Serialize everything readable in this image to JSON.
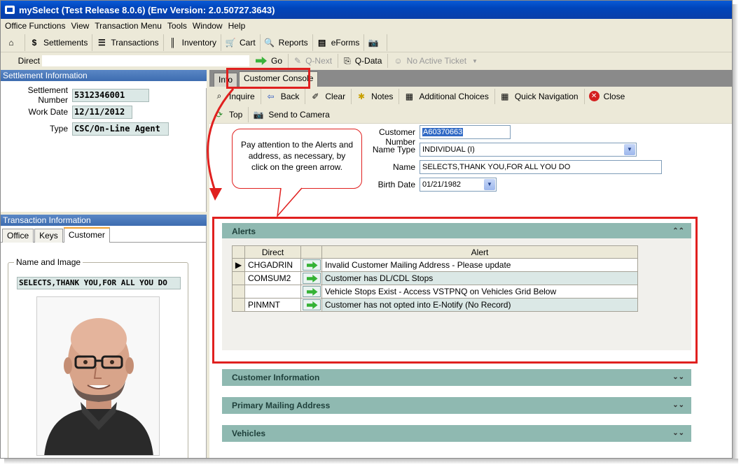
{
  "window": {
    "title": "mySelect (Test Release 8.0.6) (Env Version: 2.0.50727.3643)"
  },
  "menu": [
    "Office Functions",
    "View",
    "Transaction Menu",
    "Tools",
    "Window",
    "Help"
  ],
  "toolbar": {
    "settlements": "Settlements",
    "transactions": "Transactions",
    "inventory": "Inventory",
    "cart": "Cart",
    "reports": "Reports",
    "eforms": "eForms"
  },
  "direct_bar": {
    "label": "Direct",
    "go": "Go",
    "q_next": "Q-Next",
    "q_data": "Q-Data",
    "ticket": "No Active Ticket"
  },
  "settlement": {
    "title": "Settlement Information",
    "number_label": "Settlement Number",
    "number_value": "5312346001",
    "workdate_label": "Work Date",
    "workdate_value": "12/11/2012",
    "type_label": "Type",
    "type_value": "CSC/On-Line Agent"
  },
  "transaction": {
    "title": "Transaction Information",
    "tabs": [
      "Office",
      "Keys",
      "Customer"
    ],
    "group_label": "Name and Image",
    "name_value": "SELECTS,THANK YOU,FOR ALL YOU DO"
  },
  "console": {
    "tabs": [
      "Info",
      "Customer Console"
    ],
    "buttons": {
      "inquire": "Inquire",
      "back": "Back",
      "clear": "Clear",
      "notes": "Notes",
      "additional": "Additional Choices",
      "quicknav": "Quick Navigation",
      "close": "Close",
      "top": "Top",
      "send": "Send to Camera"
    }
  },
  "form": {
    "customer_number_label": "Customer Number",
    "customer_number_value": "A60370663",
    "name_type_label": "Name Type",
    "name_type_value": "INDIVIDUAL (I)",
    "name_label": "Name",
    "name_value": "SELECTS,THANK YOU,FOR ALL YOU DO",
    "birth_label": "Birth Date",
    "birth_value": "01/21/1982"
  },
  "callout": "Pay attention to the Alerts and address, as necessary, by click on the green arrow.",
  "sections": {
    "alerts": "Alerts",
    "customer_info": "Customer Information",
    "mailing": "Primary Mailing Address",
    "vehicles": "Vehicles"
  },
  "alerts_grid": {
    "headers": [
      "Direct",
      "Alert"
    ],
    "rows": [
      {
        "direct": "CHGADRIN",
        "alert": "Invalid Customer Mailing Address - Please update"
      },
      {
        "direct": "COMSUM2",
        "alert": "Customer has DL/CDL Stops"
      },
      {
        "direct": "",
        "alert": "Vehicle Stops Exist - Access VSTPNQ on Vehicles Grid Below"
      },
      {
        "direct": "PINMNT",
        "alert": "Customer has not opted into E-Notify (No Record)"
      }
    ]
  },
  "colors": {
    "highlight": "#e0201f",
    "section": "#8fb9b1",
    "title_bar": "#0045bb"
  }
}
